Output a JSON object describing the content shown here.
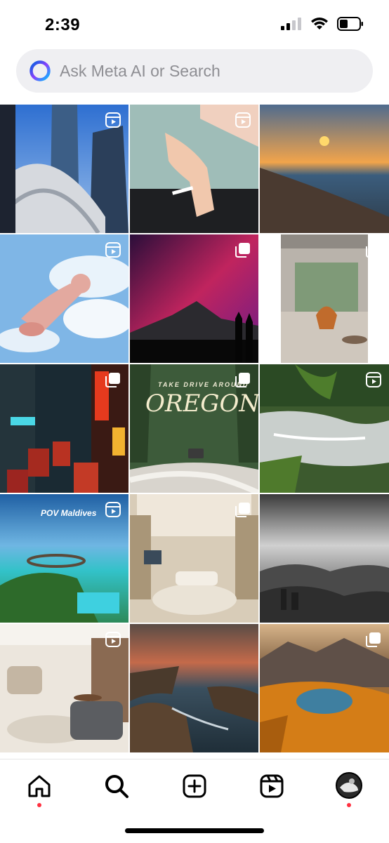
{
  "status_bar": {
    "time": "2:39",
    "icons": [
      "signal-icon",
      "wifi-icon",
      "battery-icon"
    ]
  },
  "search": {
    "placeholder": "Ask Meta AI or Search",
    "icon": "meta-ai-icon"
  },
  "grid": {
    "tiles": [
      {
        "name": "city-skyscraper",
        "badge": "reels-icon"
      },
      {
        "name": "hand-cigarette",
        "badge": "reels-icon"
      },
      {
        "name": "beach-sunset",
        "badge": ""
      },
      {
        "name": "pink-figure-sky",
        "badge": "reels-icon"
      },
      {
        "name": "aurora-mountain",
        "badge": "carousel-icon"
      },
      {
        "name": "modern-living-room",
        "badge": "carousel-icon"
      },
      {
        "name": "neon-street-night",
        "badge": "carousel-icon"
      },
      {
        "name": "oregon-road",
        "badge": "carousel-icon",
        "caption_top": "TAKE DRIVE AROUND",
        "caption_main": "OREGON"
      },
      {
        "name": "waterfall-cascade",
        "badge": "reels-icon"
      },
      {
        "name": "maldives-resort",
        "badge": "reels-icon",
        "caption": "POV Maldives"
      },
      {
        "name": "luxury-lobby",
        "badge": "carousel-icon"
      },
      {
        "name": "misty-city-valley",
        "badge": ""
      },
      {
        "name": "modern-lounge",
        "badge": "reels-icon"
      },
      {
        "name": "coastal-cliffs",
        "badge": ""
      },
      {
        "name": "autumn-lake",
        "badge": "carousel-icon"
      }
    ]
  },
  "bottom_nav": {
    "items": [
      {
        "name": "home-icon",
        "notification": true
      },
      {
        "name": "search-icon",
        "notification": false
      },
      {
        "name": "create-icon",
        "notification": false
      },
      {
        "name": "reels-icon",
        "notification": false
      },
      {
        "name": "profile-avatar",
        "notification": true
      }
    ]
  },
  "colors": {
    "accent": "#ff3040",
    "search_bg": "#efeff2",
    "placeholder": "#8e8e93"
  }
}
